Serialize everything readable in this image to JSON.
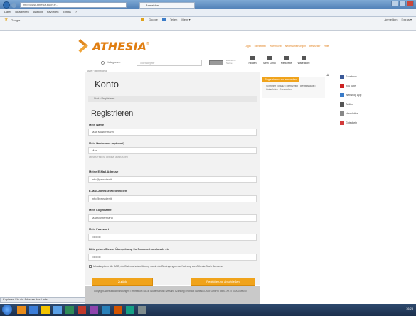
{
  "browser": {
    "address": "http://www.athesia-buch.it/...",
    "tab_title": "Anmelden",
    "menu": [
      "Datei",
      "Bearbeiten",
      "Ansicht",
      "Favoriten",
      "Extras",
      "?"
    ],
    "favorites": [
      "Google"
    ],
    "toolbar_buttons": [
      "Google",
      "Teilen",
      "Mehr ▾"
    ],
    "toolbar_right": [
      "Anmelden",
      "Extras ▾"
    ],
    "status": "Kopieren Sie die Adresse des Links..."
  },
  "site": {
    "logo_text": "ATHESIA",
    "logo_mark": "®",
    "top_links": [
      "Login",
      "Merkzettel",
      "Warenkorb",
      "Neuerscheinungen",
      "Bestseller",
      "Hilfe"
    ],
    "search": {
      "category_label": "Kategorien",
      "placeholder": "Suchbegriff",
      "advanced_label": "Erweiterte Suche"
    },
    "header_icons": [
      {
        "name": "filialen-icon",
        "label": "Filialen"
      },
      {
        "name": "mein-konto-icon",
        "label": "Mein Konto"
      },
      {
        "name": "merkzettel-icon",
        "label": "Merkzettel"
      },
      {
        "name": "warenkorb-icon",
        "label": "Warenkorb"
      }
    ],
    "breadcrumb_top": "Start › Mein Konto"
  },
  "page": {
    "title": "Konto",
    "breadcrumb": "Start › Registrieren",
    "register_title": "Registrieren",
    "fields": [
      {
        "label": "Mein Name",
        "value": "Max Mustermann"
      },
      {
        "label": "Mein Nachname (optional)",
        "value": "Max"
      },
      {
        "label": "Meine E-Mail-Adresse",
        "value": "info@provider.it"
      },
      {
        "label": "E-Mail-Adresse wiederholen",
        "value": "info@provider.it"
      },
      {
        "label": "Mein Loginname",
        "value": "MaxMustermann"
      },
      {
        "label": "Mein Passwort",
        "value": "•••••••••"
      },
      {
        "label": "Bitte geben Sie zur Überprüfung Ihr Passwort nochmals ein",
        "value": "•••••••••"
      }
    ],
    "hint_text": "Dieses Feld ist optional auszufüllen",
    "agb_text": "Ich akzeptiere die AGB, die Datenschutzerklärung sowie die Bedingungen zur Nutzung von Athesia Buch Services.",
    "buttons": {
      "back": "Zurück",
      "register": "Registrierung abschließen"
    },
    "footer": "Copyright Athesia Buchhandlungen • Impressum • AGB • Datenschutz • Versand • Zahlung • Kontakt • Athesia Druck GmbH • MwSt.-Nr. IT 00000000000"
  },
  "sidebar": {
    "promo_head": "Registrieren und einkaufen",
    "promo_text": "Schneller Einkauf • Merkzettel • Bestellstatus • Gutscheine • Newsletter",
    "social": [
      {
        "name": "facebook-icon",
        "label": "Facebook",
        "color": "#3b5998"
      },
      {
        "name": "youtube-icon",
        "label": "YouTube",
        "color": "#cc2222"
      },
      {
        "name": "webshop-icon",
        "label": "Webshop App",
        "color": "#3a7bc8"
      },
      {
        "name": "twitter-icon",
        "label": "Twitter",
        "color": "#555555"
      },
      {
        "name": "newsletter-icon",
        "label": "Newsletter",
        "color": "#888888"
      },
      {
        "name": "gift-icon",
        "label": "Gutschein",
        "color": "#d23b3b"
      }
    ]
  },
  "taskbar": {
    "clock": "16:23"
  }
}
